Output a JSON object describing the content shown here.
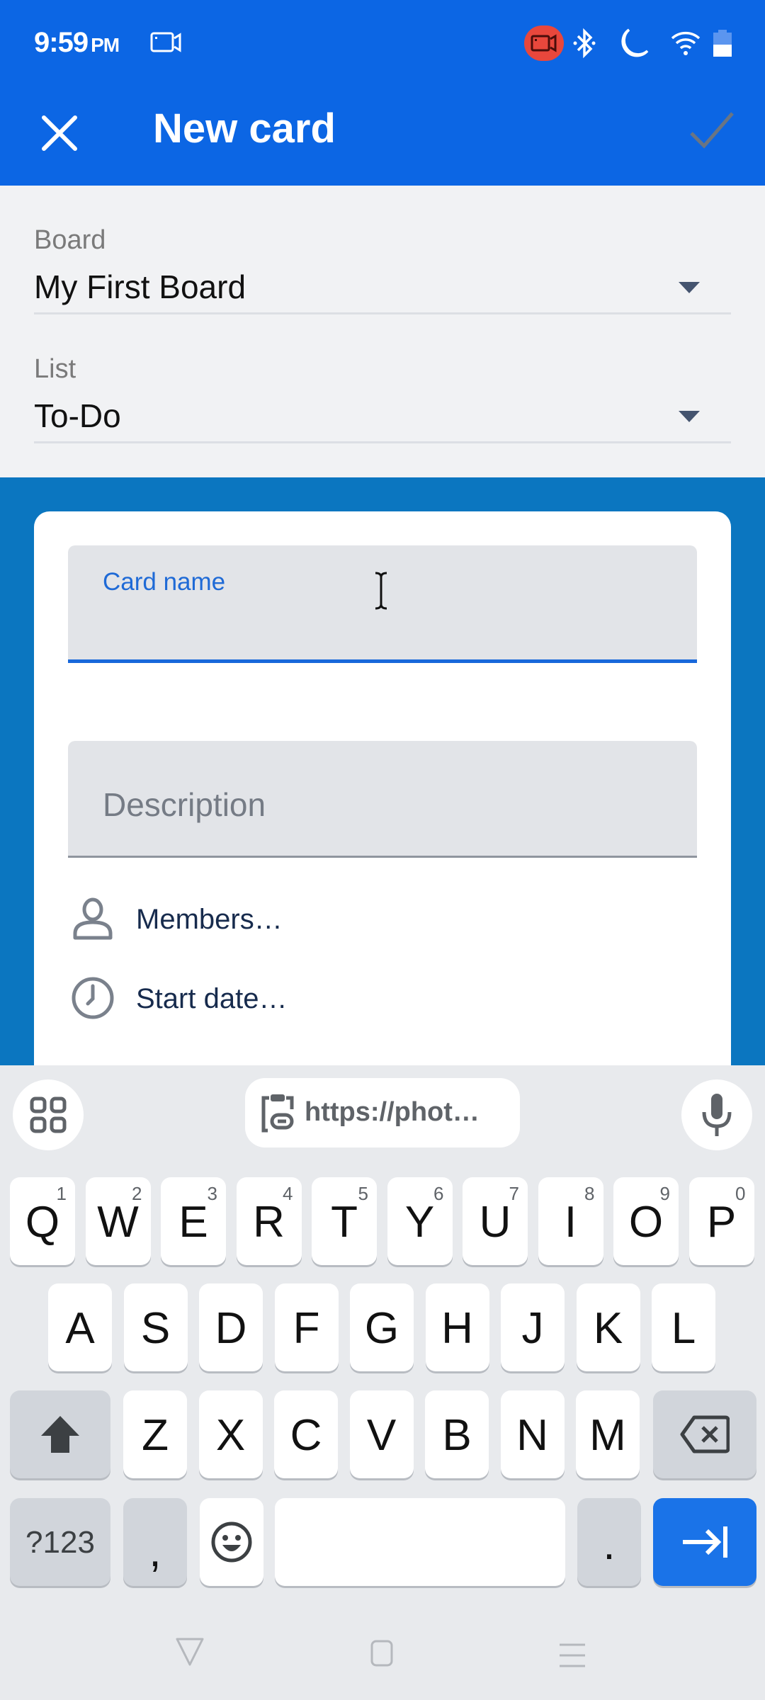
{
  "status_bar": {
    "time": "9:59",
    "ampm": "PM",
    "left_icons": [
      "screen-record-icon"
    ],
    "right_icons": [
      "recording-indicator-icon",
      "bluetooth-icon",
      "do-not-disturb-moon-icon",
      "wifi-icon",
      "battery-icon"
    ],
    "battery_level_percent": 50,
    "recording_color": "#e8473c"
  },
  "app_bar": {
    "title": "New card",
    "close_icon": "close-icon",
    "confirm_icon": "check-icon",
    "background_color": "#0c66e4"
  },
  "selectors": {
    "board": {
      "label": "Board",
      "value": "My First Board"
    },
    "list": {
      "label": "List",
      "value": "To-Do"
    }
  },
  "card_form": {
    "card_name": {
      "label": "Card name",
      "value": ""
    },
    "description": {
      "placeholder": "Description",
      "value": ""
    },
    "members": {
      "label": "Members…",
      "icon": "person-icon"
    },
    "start_date": {
      "label": "Start date…",
      "icon": "clock-icon"
    },
    "board_background_color": "#0b76c0",
    "accent_color": "#1868db"
  },
  "keyboard": {
    "toolbar": {
      "apps_icon": "grid-icon",
      "clipboard_text": "https://phot…",
      "clipboard_icon": "clipboard-link-icon",
      "mic_icon": "mic-icon"
    },
    "row1": [
      {
        "k": "Q",
        "n": "1"
      },
      {
        "k": "W",
        "n": "2"
      },
      {
        "k": "E",
        "n": "3"
      },
      {
        "k": "R",
        "n": "4"
      },
      {
        "k": "T",
        "n": "5"
      },
      {
        "k": "Y",
        "n": "6"
      },
      {
        "k": "U",
        "n": "7"
      },
      {
        "k": "I",
        "n": "8"
      },
      {
        "k": "O",
        "n": "9"
      },
      {
        "k": "P",
        "n": "0"
      }
    ],
    "row2": [
      "A",
      "S",
      "D",
      "F",
      "G",
      "H",
      "J",
      "K",
      "L"
    ],
    "row3": [
      "Z",
      "X",
      "C",
      "V",
      "B",
      "N",
      "M"
    ],
    "symbols_label": "?123",
    "comma_label": ",",
    "period_label": ".",
    "enter_color": "#1a73e8"
  },
  "nav_bar": {
    "buttons": [
      "back-icon",
      "home-icon",
      "recents-icon"
    ]
  }
}
